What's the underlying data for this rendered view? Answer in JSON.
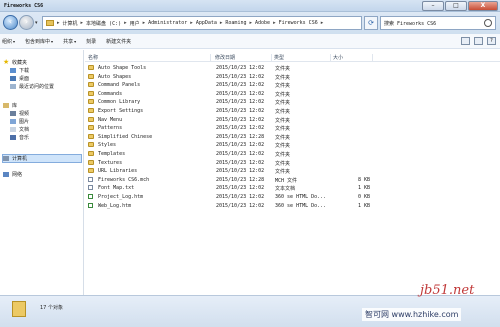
{
  "window": {
    "title": "Fireworks CS6",
    "minimize": "–",
    "maximize": "□",
    "close": "X"
  },
  "address": {
    "recent_arrow": "▾",
    "crumbs": [
      "计算机",
      "本地磁盘 (C:)",
      "用户",
      "Administrator",
      "AppData",
      "Roaming",
      "Adobe",
      "Fireworks CS6"
    ],
    "sep": "▸",
    "end_arrow": "▾",
    "refresh": "⟳",
    "search_placeholder": "搜索 Fireworks CS6"
  },
  "menu": {
    "organize": "组织",
    "include_in_library": "包含到库中",
    "share": "共享",
    "burn": "刻录",
    "new_folder": "新建文件夹",
    "arrow": "▾",
    "view_icon": "view-options-icon",
    "preview_icon": "preview-pane-icon",
    "help_icon": "help-icon",
    "help_glyph": "?"
  },
  "nav": {
    "favorites": "收藏夹",
    "downloads": "下载",
    "desktop": "桌面",
    "recent": "最近访问的位置",
    "libraries": "库",
    "videos": "视频",
    "pictures": "图片",
    "documents": "文档",
    "music": "音乐",
    "computer": "计算机",
    "network": "网络"
  },
  "columns": {
    "name": "名称",
    "date": "修改日期",
    "type": "类型",
    "size": "大小"
  },
  "files": [
    {
      "name": "Auto Shape Tools",
      "date": "2015/10/23 12:02",
      "type": "文件夹",
      "size": "",
      "icon": "folder"
    },
    {
      "name": "Auto Shapes",
      "date": "2015/10/23 12:02",
      "type": "文件夹",
      "size": "",
      "icon": "folder"
    },
    {
      "name": "Command Panels",
      "date": "2015/10/23 12:02",
      "type": "文件夹",
      "size": "",
      "icon": "folder"
    },
    {
      "name": "Commands",
      "date": "2015/10/23 12:02",
      "type": "文件夹",
      "size": "",
      "icon": "folder"
    },
    {
      "name": "Common Library",
      "date": "2015/10/23 12:02",
      "type": "文件夹",
      "size": "",
      "icon": "folder"
    },
    {
      "name": "Export Settings",
      "date": "2015/10/23 12:02",
      "type": "文件夹",
      "size": "",
      "icon": "folder"
    },
    {
      "name": "Nav Menu",
      "date": "2015/10/23 12:02",
      "type": "文件夹",
      "size": "",
      "icon": "folder"
    },
    {
      "name": "Patterns",
      "date": "2015/10/23 12:02",
      "type": "文件夹",
      "size": "",
      "icon": "folder"
    },
    {
      "name": "Simplified Chinese",
      "date": "2015/10/23 12:28",
      "type": "文件夹",
      "size": "",
      "icon": "folder"
    },
    {
      "name": "Styles",
      "date": "2015/10/23 12:02",
      "type": "文件夹",
      "size": "",
      "icon": "folder"
    },
    {
      "name": "Templates",
      "date": "2015/10/23 12:02",
      "type": "文件夹",
      "size": "",
      "icon": "folder"
    },
    {
      "name": "Textures",
      "date": "2015/10/23 12:02",
      "type": "文件夹",
      "size": "",
      "icon": "folder"
    },
    {
      "name": "URL Libraries",
      "date": "2015/10/23 12:02",
      "type": "文件夹",
      "size": "",
      "icon": "folder"
    },
    {
      "name": "Fireworks CS6.mch",
      "date": "2015/10/23 12:28",
      "type": "MCH 文件",
      "size": "8 KB",
      "icon": "file"
    },
    {
      "name": "Font Map.txt",
      "date": "2015/10/23 12:02",
      "type": "文本文档",
      "size": "1 KB",
      "icon": "file"
    },
    {
      "name": "Project_Log.htm",
      "date": "2015/10/23 12:02",
      "type": "360 se HTML Do...",
      "size": "0 KB",
      "icon": "htm"
    },
    {
      "name": "Web_Log.htm",
      "date": "2015/10/23 12:02",
      "type": "360 se HTML Do...",
      "size": "1 KB",
      "icon": "htm"
    }
  ],
  "status": {
    "count": "17 个对象"
  },
  "watermark": {
    "site1": "jb51.net",
    "site2": "智可网 www.hzhike.com"
  }
}
